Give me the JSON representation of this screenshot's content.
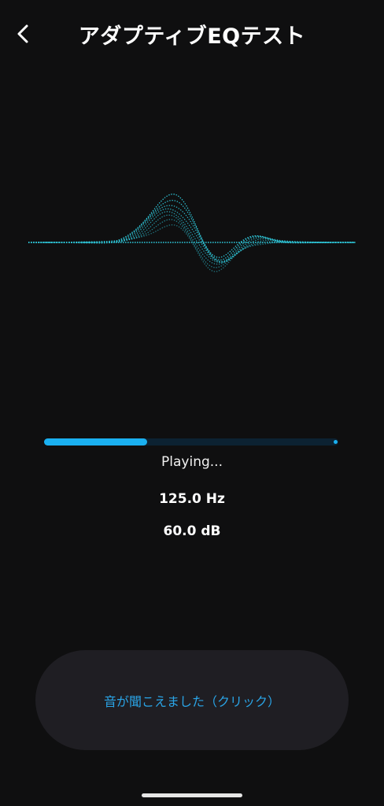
{
  "header": {
    "title": "アダプティブEQテスト",
    "back_icon": "chevron-left-icon"
  },
  "colors": {
    "accent": "#1ab0f0",
    "wave": "#2fc6d8",
    "button_text": "#2aa4e6",
    "button_bg": "#1f1e23",
    "background": "#0f0f10"
  },
  "test": {
    "progress": 0.35,
    "status": "Playing...",
    "frequency": "125.0 Hz",
    "level": "60.0 dB"
  },
  "actions": {
    "heard_label": "音が聞こえました（クリック）"
  }
}
